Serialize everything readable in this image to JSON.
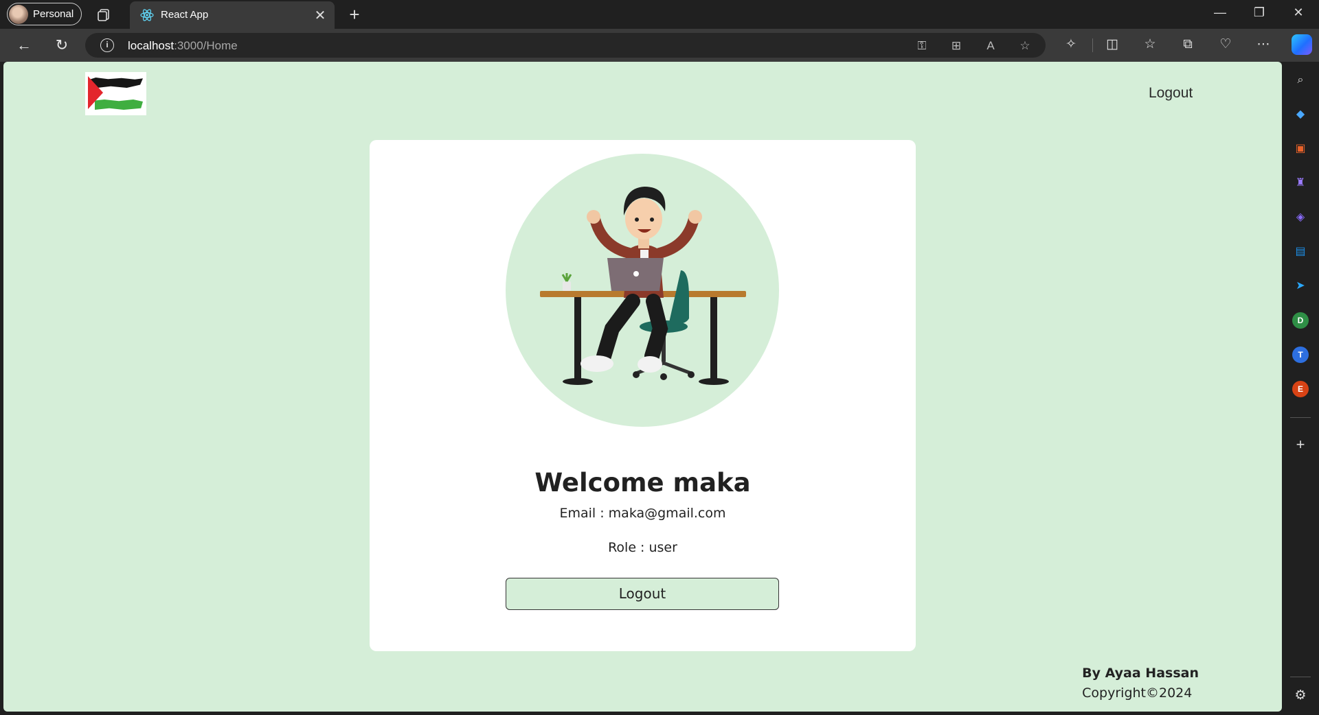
{
  "browser": {
    "profile_label": "Personal",
    "tab_title": "React App",
    "url_host": "localhost",
    "url_rest": ":3000/Home"
  },
  "page": {
    "nav_logout": "Logout",
    "welcome": "Welcome maka",
    "email": "Email : maka@gmail.com",
    "role": "Role : user",
    "logout_button": "Logout",
    "footer_author": "By Ayaa Hassan",
    "footer_copyright": "Copyright©2024"
  },
  "sidebar": {
    "d_label": "D",
    "t_label": "T",
    "e_label": "E"
  },
  "colors": {
    "page_background": "#d5eed8",
    "card_background": "#ffffff",
    "browser_chrome": "#202020"
  }
}
